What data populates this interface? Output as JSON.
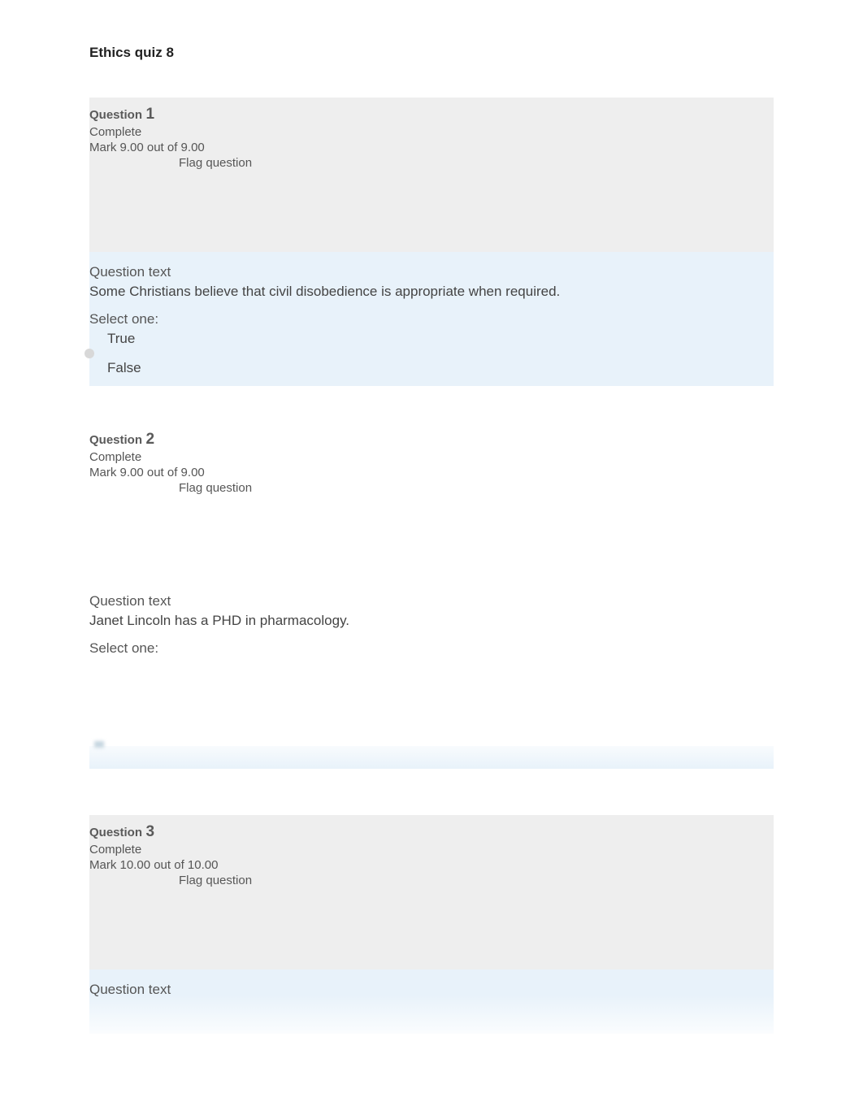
{
  "page": {
    "title": "Ethics quiz 8"
  },
  "questions": [
    {
      "label": "Question",
      "number": "1",
      "status": "Complete",
      "mark": "Mark 9.00 out of 9.00",
      "flag": "Flag question",
      "text_label": "Question text",
      "prompt": "Some Christians believe that civil disobedience is appropriate when required.",
      "select_one": "Select one:",
      "option_true": "True",
      "option_false": "False"
    },
    {
      "label": "Question",
      "number": "2",
      "status": "Complete",
      "mark": "Mark 9.00 out of 9.00",
      "flag": "Flag question",
      "text_label": "Question text",
      "prompt": "Janet Lincoln has a PHD in pharmacology.",
      "select_one": "Select one:"
    },
    {
      "label": "Question",
      "number": "3",
      "status": "Complete",
      "mark": "Mark 10.00 out of 10.00",
      "flag": "Flag question",
      "text_label": "Question text"
    }
  ]
}
